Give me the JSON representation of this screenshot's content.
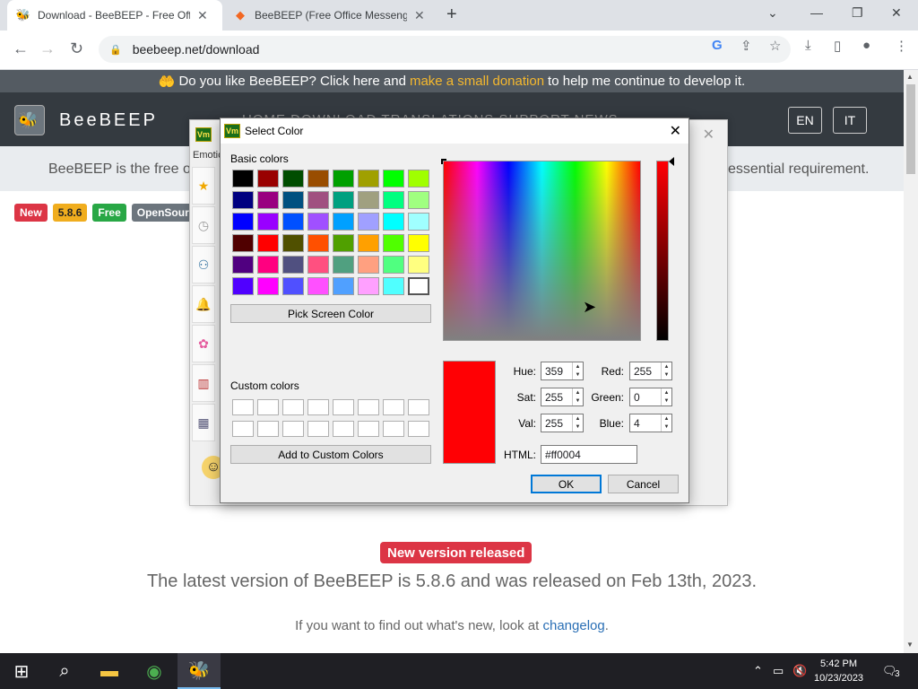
{
  "browser": {
    "tabs": [
      {
        "title": "Download - BeeBEEP - Free Offic",
        "icon": "bee-icon",
        "active": true
      },
      {
        "title": "BeeBEEP (Free Office Messenger)",
        "icon": "sourceforge-icon",
        "active": false
      }
    ],
    "url": "beebeep.net/download"
  },
  "page": {
    "donate_prefix": "Do you like BeeBEEP? Click here and",
    "donate_link": "make a small donation",
    "donate_suffix": "to help me continue to develop it.",
    "brand": "BeeBEEP",
    "nav": "HOME   DOWNLOAD   TRANSLATIONS   SUPPORT   NEWS",
    "lang_en": "EN",
    "lang_it": "IT",
    "intro_left": "BeeBEEP is the free offi",
    "intro_right": "essential requirement.",
    "badges": [
      {
        "label": "New",
        "color": "#dc3545"
      },
      {
        "label": "5.8.6",
        "color": "#f0ad1e"
      },
      {
        "label": "Free",
        "color": "#28a745"
      },
      {
        "label": "OpenSource",
        "color": "#6c757d"
      }
    ],
    "new_version": "New version released",
    "latest": "The latest version of BeeBEEP is 5.8.6 and was released on Feb 13th, 2023.",
    "changelog_prefix": "If you want to find out what's new, look at",
    "changelog_link": "changelog",
    "changelog_suffix": "."
  },
  "background_window": {
    "label": "Emotic",
    "icon_label": "Vm"
  },
  "dialog": {
    "title": "Select Color",
    "icon_label": "Vm",
    "basic_colors_label": "Basic colors",
    "basic_colors": [
      "#000000",
      "#990000",
      "#004d00",
      "#994d00",
      "#00a000",
      "#a0a000",
      "#00ff00",
      "#a0ff00",
      "#000080",
      "#990080",
      "#005080",
      "#a05080",
      "#00a080",
      "#a0a080",
      "#00ff80",
      "#a0ff80",
      "#0000ff",
      "#9900ff",
      "#0050ff",
      "#a050ff",
      "#00a0ff",
      "#a0a0ff",
      "#00ffff",
      "#a0ffff",
      "#500000",
      "#ff0000",
      "#505000",
      "#ff5000",
      "#50a000",
      "#ffa000",
      "#50ff00",
      "#ffff00",
      "#500080",
      "#ff0080",
      "#505080",
      "#ff5080",
      "#50a080",
      "#ffa080",
      "#50ff80",
      "#ffff80",
      "#5000ff",
      "#ff00ff",
      "#5050ff",
      "#ff50ff",
      "#50a0ff",
      "#ffa0ff",
      "#50ffff",
      "#ffffff"
    ],
    "selected_index": 47,
    "pick_screen_label": "Pick Screen Color",
    "custom_colors_label": "Custom colors",
    "add_custom_label": "Add to Custom Colors",
    "current_color": "#ff0004",
    "fields": {
      "hue_label": "Hue:",
      "hue": "359",
      "sat_label": "Sat:",
      "sat": "255",
      "val_label": "Val:",
      "val": "255",
      "red_label": "Red:",
      "red": "255",
      "green_label": "Green:",
      "green": "0",
      "blue_label": "Blue:",
      "blue": "4",
      "html_label": "HTML:",
      "html": "#ff0004"
    },
    "ok_label": "OK",
    "cancel_label": "Cancel"
  },
  "taskbar": {
    "time": "5:42 PM",
    "date": "10/23/2023",
    "notifications": "3"
  }
}
